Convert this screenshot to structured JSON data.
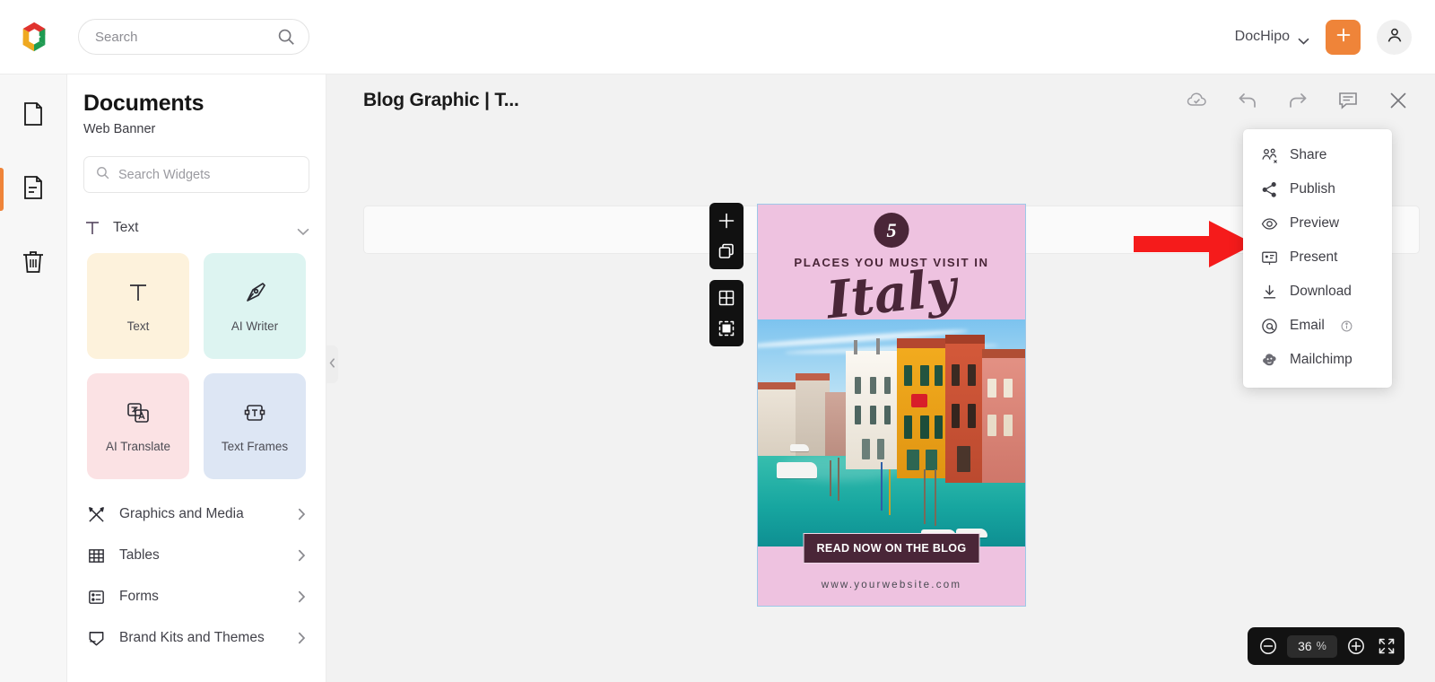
{
  "app": {
    "name": "DocHipo",
    "logo_icon": "dochipo-logo-icon"
  },
  "topbar": {
    "search_placeholder": "Search",
    "search_value": "",
    "search_icon": "search-icon",
    "brand_label": "DocHipo",
    "brand_chevron_icon": "chevron-down-icon",
    "create_button_icon": "plus-icon",
    "account_button_icon": "user-avatar-icon"
  },
  "rail": {
    "items": [
      {
        "name": "documents",
        "icon": "blank-document-icon",
        "active": false
      },
      {
        "name": "templates",
        "icon": "document-lines-icon",
        "active": true
      },
      {
        "name": "trash",
        "icon": "trash-icon",
        "active": false
      }
    ]
  },
  "sidebar": {
    "title": "Documents",
    "subtitle": "Web Banner",
    "widget_search_placeholder": "Search Widgets",
    "widget_search_value": "",
    "widget_search_icon": "search-icon",
    "text_category": {
      "label": "Text",
      "icon": "text-T-icon",
      "chevron_icon": "chevron-down-icon"
    },
    "widgets": [
      {
        "label": "Text",
        "icon": "text-T-icon",
        "bg": "#fdf2dc"
      },
      {
        "label": "AI Writer",
        "icon": "pen-nib-icon",
        "bg": "#ddf4f1"
      },
      {
        "label": "AI Translate",
        "icon": "translate-icon",
        "bg": "#fbe2e4"
      },
      {
        "label": "Text Frames",
        "icon": "text-frame-icon",
        "bg": "#dde6f4"
      }
    ],
    "categories": [
      {
        "label": "Graphics and Media",
        "icon": "graphics-media-icon",
        "chevron": "chevron-right-icon"
      },
      {
        "label": "Tables",
        "icon": "table-grid-icon",
        "chevron": "chevron-right-icon"
      },
      {
        "label": "Forms",
        "icon": "forms-icon",
        "chevron": "chevron-right-icon"
      },
      {
        "label": "Brand Kits and Themes",
        "icon": "brand-kit-icon",
        "chevron": "chevron-right-icon"
      }
    ],
    "collapse_handle_icon": "chevron-left-icon"
  },
  "editor": {
    "document_title": "Blog Graphic | T...",
    "actions": [
      {
        "name": "cloud-saved",
        "icon": "cloud-check-icon"
      },
      {
        "name": "undo",
        "icon": "undo-arrow-icon"
      },
      {
        "name": "redo",
        "icon": "redo-arrow-icon"
      },
      {
        "name": "comments",
        "icon": "comment-bubble-icon"
      },
      {
        "name": "close",
        "icon": "close-x-icon"
      }
    ],
    "toolbar": {
      "pattern_button_icon": "diagonal-stripes-swatch-icon"
    },
    "float_tools": [
      [
        {
          "name": "add-page",
          "icon": "plus-icon"
        },
        {
          "name": "duplicate-page",
          "icon": "copy-duplicate-icon"
        }
      ],
      [
        {
          "name": "grid-layout",
          "icon": "grid-four-icon"
        },
        {
          "name": "select-area",
          "icon": "crop-select-icon"
        }
      ]
    ]
  },
  "design": {
    "badge_number": "5",
    "kicker": "PLACES YOU MUST VISIT IN",
    "script_word": "Italy",
    "cta_label": "READ NOW ON THE BLOG",
    "website_url": "www.yourwebsite.com",
    "colors": {
      "pink_bg": "#eec2e0",
      "dark_plum": "#4a2638",
      "selection_border": "#9ec8e8"
    },
    "photo_description": "Venice Grand Canal with colorful buildings and boats"
  },
  "menu": {
    "items": [
      {
        "label": "Share",
        "icon": "share-people-icon",
        "has_info": false
      },
      {
        "label": "Publish",
        "icon": "share-nodes-icon",
        "has_info": false
      },
      {
        "label": "Preview",
        "icon": "eye-icon",
        "has_info": false
      },
      {
        "label": "Present",
        "icon": "presentation-screen-icon",
        "has_info": false
      },
      {
        "label": "Download",
        "icon": "download-arrow-icon",
        "has_info": false
      },
      {
        "label": "Email",
        "icon": "at-sign-icon",
        "has_info": true,
        "info_icon": "info-circle-icon"
      },
      {
        "label": "Mailchimp",
        "icon": "mailchimp-monkey-icon",
        "has_info": false
      }
    ]
  },
  "annotation": {
    "arrow_color": "#f51b1b",
    "arrow_points_to": "Present"
  },
  "zoom_bar": {
    "zoom_out_icon": "minus-circle-icon",
    "zoom_value": "36",
    "zoom_unit": "%",
    "zoom_in_icon": "plus-circle-icon",
    "fullscreen_icon": "expand-arrows-icon"
  }
}
